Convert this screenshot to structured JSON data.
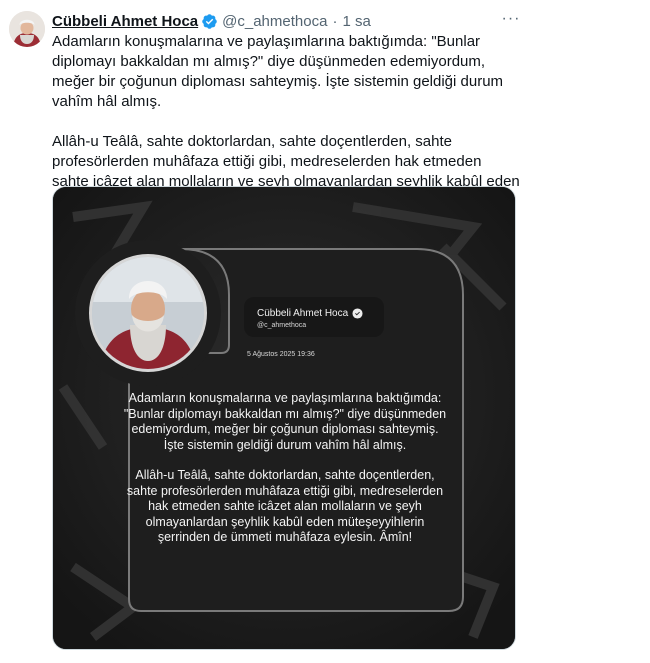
{
  "tweet": {
    "author_name": "Cübbeli Ahmet Hoca",
    "handle": "@c_ahmethoca",
    "separator": "·",
    "time": "1 sa",
    "more_label": "···",
    "paragraphs": [
      "Adamların konuşmalarına ve paylaşımlarına baktığımda: \"Bunlar diplomayı bakkaldan mı almış?\" diye düşünmeden edemiyordum, meğer bir çoğunun diploması sahteymiş. İşte sistemin geldiği durum vahîm hâl almış.",
      "Allâh-u Teâlâ, sahte doktorlardan, sahte doçentlerden, sahte profesörlerden muhâfaza ettiği gibi, medreselerden hak etmeden sahte icâzet alan mollaların ve şeyh olmayanlardan şeyhlik kabûl eden müteşeyyihlerin şerrinden de ümmeti muhâfaza eylesin. Âmîn!"
    ]
  },
  "card": {
    "name": "Cübbeli Ahmet Hoca",
    "handle": "@c_ahmethoca",
    "date": "5 Ağustos 2025 19:36",
    "paragraphs": [
      "Adamların konuşmalarına ve paylaşımlarına baktığımda: \"Bunlar diplomayı bakkaldan mı almış?\" diye düşünmeden edemiyordum, meğer bir çoğunun diploması sahteymiş. İşte sistemin geldiği durum vahîm hâl almış.",
      "Allâh-u Teâlâ, sahte doktorlardan, sahte doçentlerden, sahte profesörlerden muhâfaza ettiği gibi, medreselerden hak etmeden sahte icâzet alan mollaların ve şeyh olmayanlardan şeyhlik kabûl eden müteşeyyihlerin şerrinden de ümmeti muhâfaza eylesin. Âmîn!"
    ]
  },
  "icons": {
    "verified": "verified-badge-icon",
    "more": "more-options-icon"
  },
  "colors": {
    "verified": "#1d9bf0",
    "text": "#0f1419",
    "muted": "#536471",
    "card_bg": "#232323"
  }
}
